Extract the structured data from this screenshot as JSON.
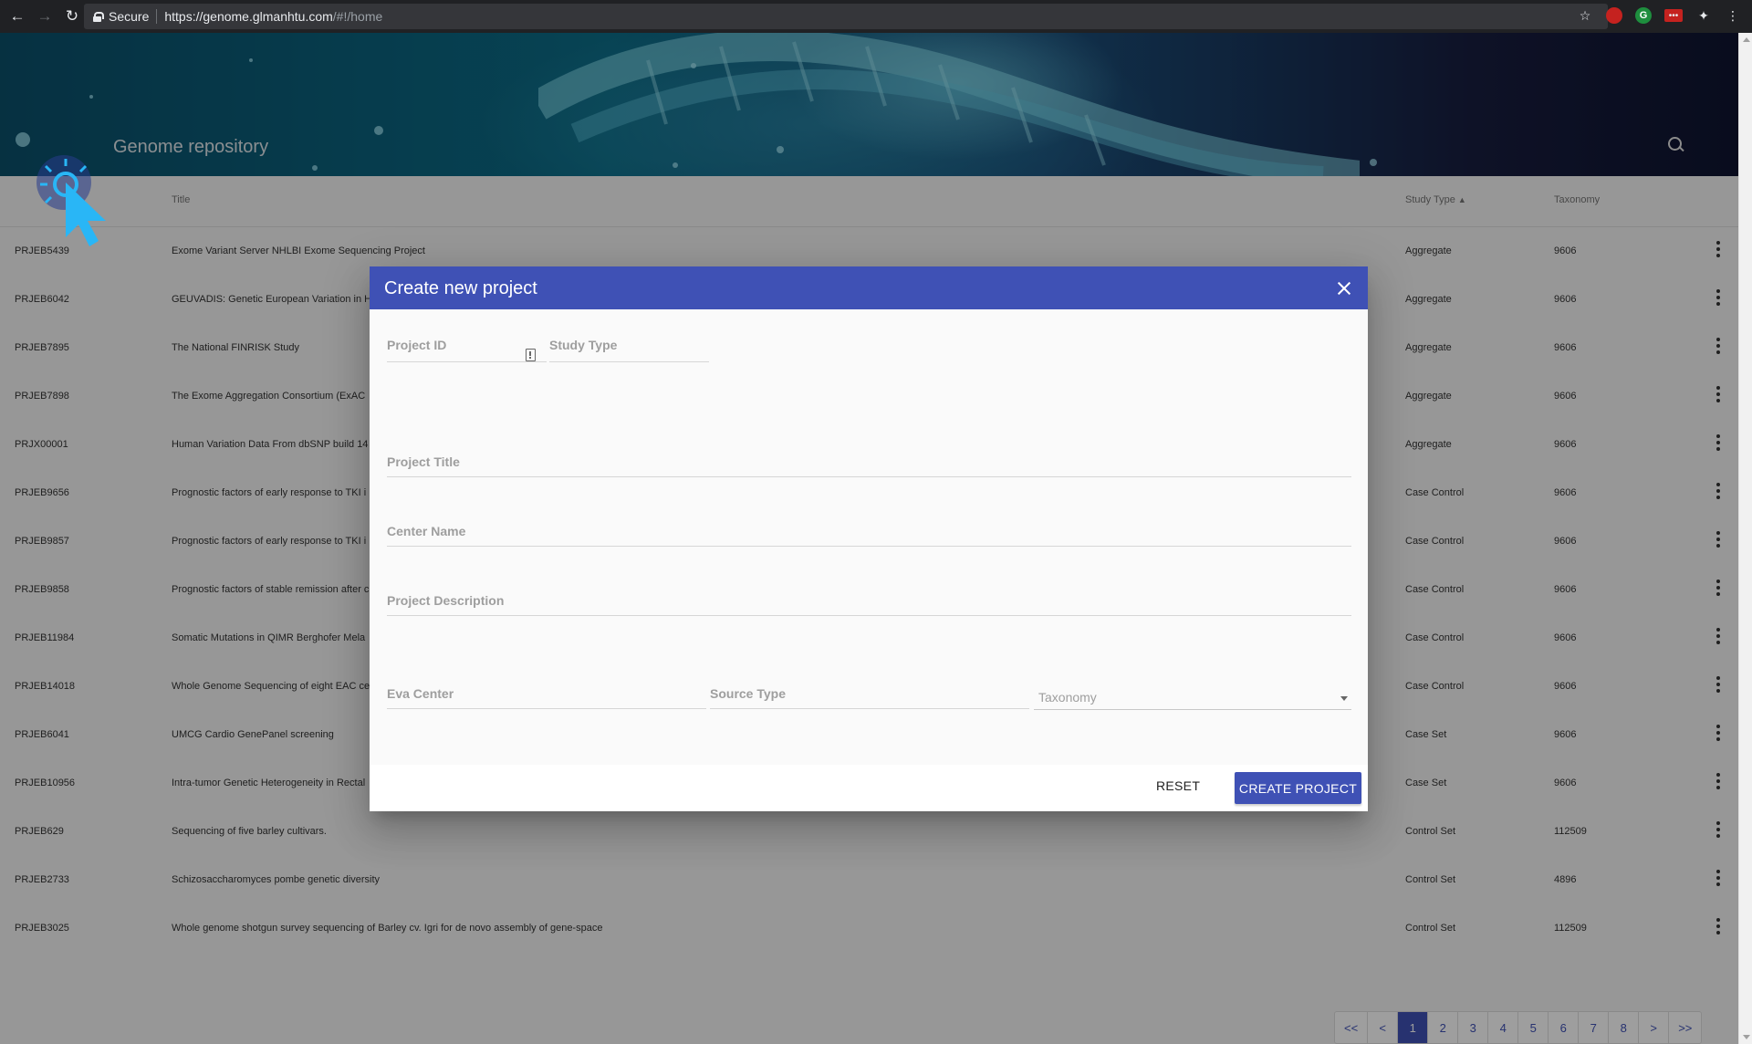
{
  "browser": {
    "secure_label": "Secure",
    "url_host": "https://genome.glmanhtu.com",
    "url_path": "/#!/home",
    "icons": [
      "back-icon",
      "forward-icon",
      "reload-icon",
      "lock-icon",
      "star-icon",
      "kebab-menu-icon"
    ]
  },
  "header": {
    "title": "Genome repository",
    "search_icon": "search-icon"
  },
  "table": {
    "columns": {
      "title": "Title",
      "study_type": "Study Type",
      "taxonomy": "Taxonomy"
    },
    "rows": [
      {
        "id": "PRJEB5439",
        "title": "Exome Variant Server NHLBI Exome Sequencing Project",
        "study_type": "Aggregate",
        "taxonomy": "9606"
      },
      {
        "id": "PRJEB6042",
        "title": "GEUVADIS: Genetic European Variation in H",
        "study_type": "Aggregate",
        "taxonomy": "9606"
      },
      {
        "id": "PRJEB7895",
        "title": "The National FINRISK Study",
        "study_type": "Aggregate",
        "taxonomy": "9606"
      },
      {
        "id": "PRJEB7898",
        "title": "The Exome Aggregation Consortium (ExAC",
        "study_type": "Aggregate",
        "taxonomy": "9606"
      },
      {
        "id": "PRJX00001",
        "title": "Human Variation Data From dbSNP build 14",
        "study_type": "Aggregate",
        "taxonomy": "9606"
      },
      {
        "id": "PRJEB9656",
        "title": "Prognostic factors of early response to TKI i",
        "study_type": "Case Control",
        "taxonomy": "9606"
      },
      {
        "id": "PRJEB9857",
        "title": "Prognostic factors of early response to TKI i",
        "study_type": "Case Control",
        "taxonomy": "9606"
      },
      {
        "id": "PRJEB9858",
        "title": "Prognostic factors of stable remission after c",
        "study_type": "Case Control",
        "taxonomy": "9606"
      },
      {
        "id": "PRJEB11984",
        "title": "Somatic Mutations in QIMR Berghofer Mela",
        "study_type": "Case Control",
        "taxonomy": "9606"
      },
      {
        "id": "PRJEB14018",
        "title": "Whole Genome Sequencing of eight EAC ce",
        "study_type": "Case Control",
        "taxonomy": "9606"
      },
      {
        "id": "PRJEB6041",
        "title": "UMCG Cardio GenePanel screening",
        "study_type": "Case Set",
        "taxonomy": "9606"
      },
      {
        "id": "PRJEB10956",
        "title": "Intra-tumor Genetic Heterogeneity in Rectal",
        "study_type": "Case Set",
        "taxonomy": "9606"
      },
      {
        "id": "PRJEB629",
        "title": "Sequencing of five barley cultivars.",
        "study_type": "Control Set",
        "taxonomy": "112509"
      },
      {
        "id": "PRJEB2733",
        "title": "Schizosaccharomyces pombe genetic diversity",
        "study_type": "Control Set",
        "taxonomy": "4896"
      },
      {
        "id": "PRJEB3025",
        "title": "Whole genome shotgun survey sequencing of Barley cv. Igri for de novo assembly of gene-space",
        "study_type": "Control Set",
        "taxonomy": "112509"
      }
    ]
  },
  "pager": {
    "items": [
      "<<",
      "<",
      "1",
      "2",
      "3",
      "4",
      "5",
      "6",
      "7",
      "8",
      ">",
      ">>"
    ],
    "active": "1"
  },
  "dialog": {
    "title": "Create new project",
    "fields": {
      "project_id": "Project ID",
      "study_type": "Study Type",
      "project_title": "Project Title",
      "center_name": "Center Name",
      "project_description": "Project Description",
      "eva_center": "Eva Center",
      "source_type": "Source Type",
      "taxonomy": "Taxonomy"
    },
    "reset_label": "RESET",
    "create_label": "CREATE PROJECT"
  },
  "colors": {
    "primary": "#3f51b5",
    "overlay": "rgba(0,0,0,0.38)"
  }
}
